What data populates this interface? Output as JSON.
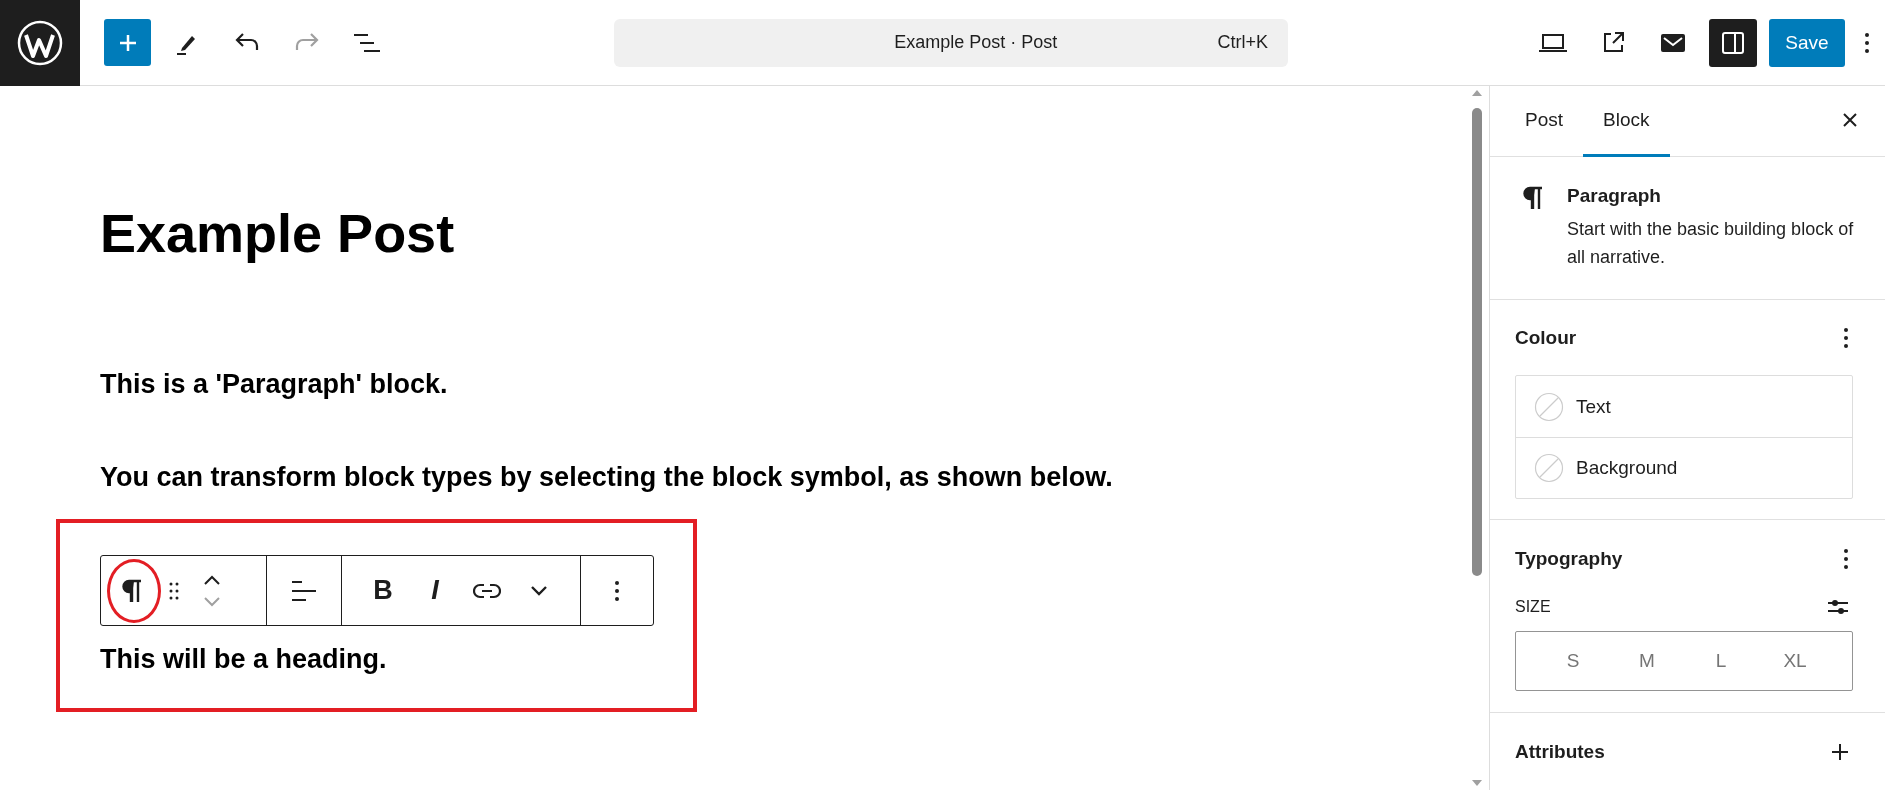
{
  "top_bar": {
    "command": {
      "title": "Example Post · Post",
      "shortcut": "Ctrl+K"
    },
    "history": [
      {
        "kind": "undo",
        "disabled": false
      },
      {
        "kind": "redo",
        "disabled": true
      }
    ],
    "sidebar_toggle": {
      "on": true
    },
    "save": "Save"
  },
  "editor": {
    "title": "Example Post",
    "paragraphs": [
      "This is a 'Paragraph' block.",
      "You can transform block types by selecting the block symbol, as shown below."
    ],
    "block_toolbar": {
      "movers": [
        {
          "kind": "up",
          "disabled": false
        },
        {
          "kind": "down",
          "disabled": true
        }
      ],
      "format": [
        {
          "kind": "bold",
          "label": "B"
        },
        {
          "kind": "italic",
          "label": "I"
        },
        {
          "kind": "link"
        },
        {
          "kind": "more"
        }
      ]
    },
    "selected_block": "This will be a heading."
  },
  "sidebar": {
    "tabs": [
      {
        "label": "Post",
        "selected": false
      },
      {
        "label": "Block",
        "selected": true
      }
    ],
    "block": {
      "name": "Paragraph",
      "description": "Start with the basic building block of all narrative."
    },
    "colour": {
      "title": "Colour",
      "items": [
        "Text",
        "Background"
      ]
    },
    "typography": {
      "title": "Typography",
      "size_label": "SIZE",
      "sizes": [
        "S",
        "M",
        "L",
        "XL"
      ]
    },
    "attributes": {
      "title": "Attributes"
    }
  }
}
